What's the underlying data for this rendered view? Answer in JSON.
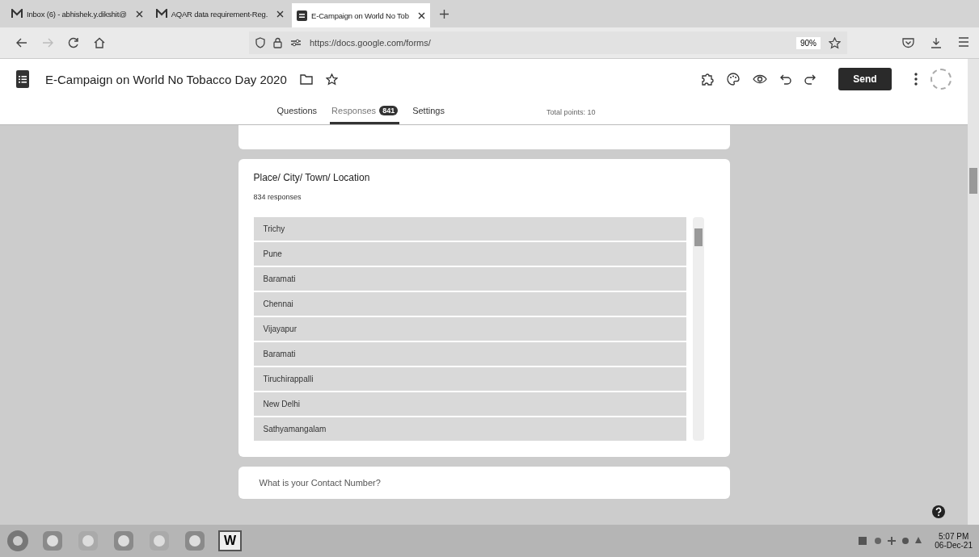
{
  "browser_tabs": [
    {
      "label": "Inbox (6) - abhishek.y.dikshit@",
      "kind": "mail",
      "selected": false
    },
    {
      "label": "AQAR data requirement-Reg.",
      "kind": "mail",
      "selected": false
    },
    {
      "label": "E-Campaign on World No Tob",
      "kind": "forms",
      "selected": true
    }
  ],
  "address_bar": {
    "url": "https://docs.google.com/forms/",
    "zoom": "90%"
  },
  "form_header": {
    "title": "E-Campaign on World No Tobacco Day 2020",
    "send": "Send"
  },
  "form_tabs": [
    {
      "label": "Questions",
      "selected": false
    },
    {
      "label": "Responses",
      "badge": "841",
      "selected": true
    },
    {
      "label": "Settings",
      "selected": false
    }
  ],
  "total_points": "Total points: 10",
  "question": {
    "title": "Place/ City/ Town/ Location",
    "count": "834 responses",
    "answers": [
      "Trichy",
      "Pune",
      "Baramati",
      "Chennai",
      "Vijayapur",
      "Baramati",
      "Tiruchirappalli",
      "New Delhi",
      "Sathyamangalam"
    ]
  },
  "next_question": {
    "title": "What is your Contact Number?"
  },
  "taskbar": {
    "time": "5:07 PM",
    "date": "06-Dec-21",
    "app_label": "W"
  }
}
